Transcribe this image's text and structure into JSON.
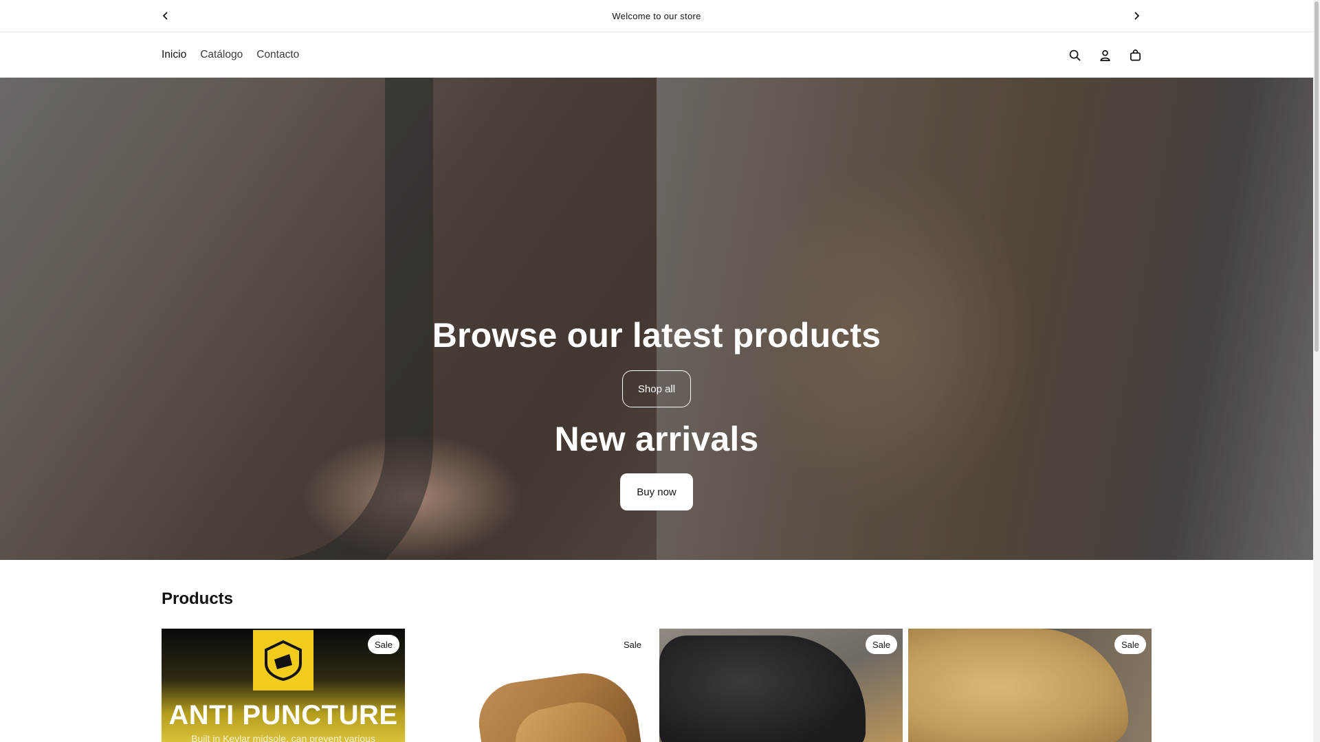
{
  "announcement": {
    "message": "Welcome to our store",
    "prev_icon": "chevron-left-icon",
    "next_icon": "chevron-right-icon"
  },
  "header": {
    "nav": [
      {
        "label": "Inicio",
        "active": true
      },
      {
        "label": "Catálogo",
        "active": false
      },
      {
        "label": "Contacto",
        "active": false
      }
    ],
    "icons": [
      "search-icon",
      "account-icon",
      "cart-icon"
    ]
  },
  "hero": {
    "title_1": "Browse our latest products",
    "button_1": "Shop all",
    "title_2": "New arrivals",
    "button_2": "Buy now"
  },
  "products": {
    "title": "Products",
    "cards": [
      {
        "badge": "Sale",
        "image_text": "ANTI PUNCTURE",
        "image_subtext": "Built in Kevlar midsole, can prevent various"
      },
      {
        "badge": "Sale"
      },
      {
        "badge": "Sale"
      },
      {
        "badge": "Sale"
      }
    ]
  },
  "colors": {
    "text": "#121212",
    "background": "#ffffff",
    "badge_bg": "#ffffff",
    "logo_yellow": "#f1cc1a"
  }
}
